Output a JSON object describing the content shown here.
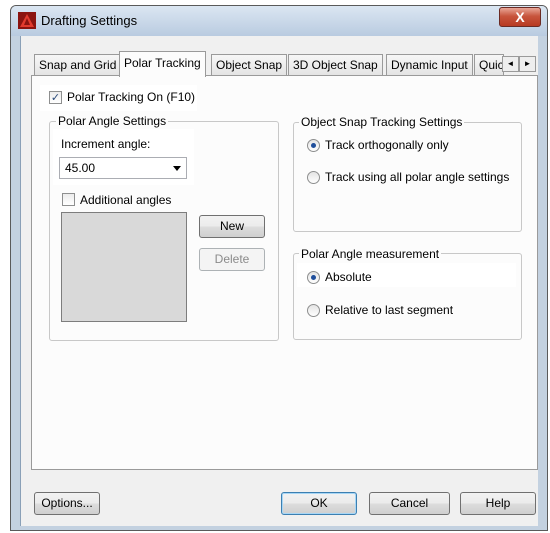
{
  "window": {
    "title": "Drafting Settings",
    "close_label": "X"
  },
  "tabs": [
    {
      "label": "Snap and Grid"
    },
    {
      "label": "Polar Tracking"
    },
    {
      "label": "Object Snap"
    },
    {
      "label": "3D Object Snap"
    },
    {
      "label": "Dynamic Input"
    },
    {
      "label": "Quic"
    }
  ],
  "tab_scroll": {
    "left": "◄",
    "right": "►"
  },
  "polar": {
    "toggle_label": "Polar Tracking On (F10)",
    "toggle_checked": "✓",
    "angle_group": "Polar Angle Settings",
    "increment_label": "Increment angle:",
    "increment_value": "45.00",
    "additional_label": "Additional angles",
    "new_button": "New",
    "delete_button": "Delete"
  },
  "snap_tracking": {
    "group": "Object Snap Tracking Settings",
    "option_orthogonal": "Track orthogonally only",
    "option_all": "Track using all polar angle settings",
    "selected": "orthogonal"
  },
  "measurement": {
    "group": "Polar Angle measurement",
    "option_absolute": "Absolute",
    "option_relative": "Relative to last segment",
    "selected": "absolute"
  },
  "footer": {
    "options": "Options...",
    "ok": "OK",
    "cancel": "Cancel",
    "help": "Help"
  },
  "colors": {
    "titlebar": "#c3d1e0",
    "close": "#c8553d",
    "radio_dot": "#1f4e9b",
    "highlight": "#ffffff"
  }
}
